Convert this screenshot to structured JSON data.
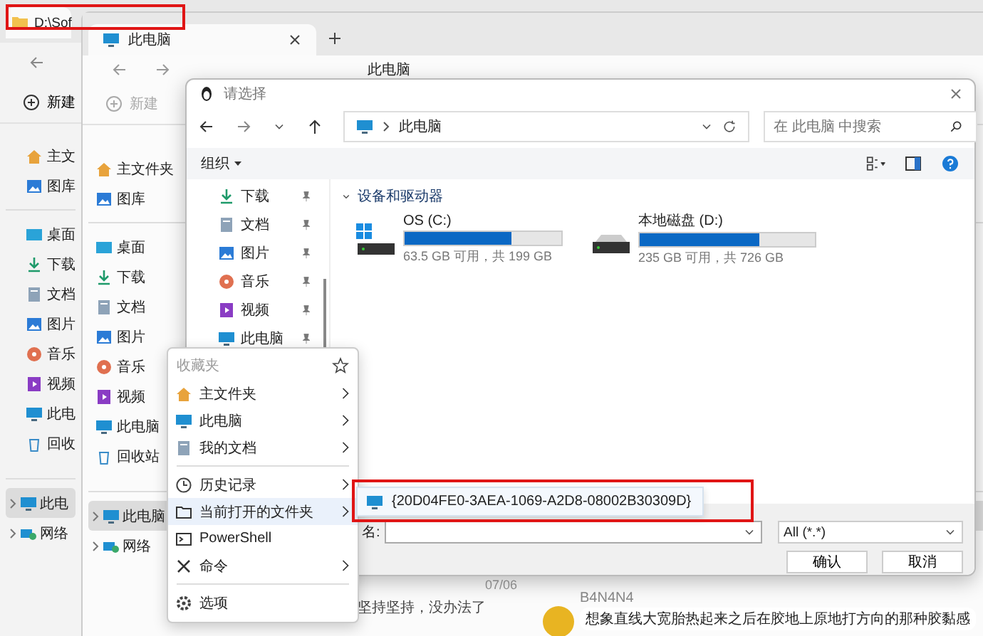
{
  "back_window": {
    "tab": "D:\\Sof",
    "new_button": "新建",
    "sidebar": [
      [
        {
          "label": "主文",
          "kind": "home"
        },
        {
          "label": "图库",
          "kind": "gallery"
        }
      ],
      [
        {
          "label": "桌面",
          "kind": "desktop"
        },
        {
          "label": "下载",
          "kind": "download"
        },
        {
          "label": "文档",
          "kind": "document"
        },
        {
          "label": "图片",
          "kind": "picture"
        },
        {
          "label": "音乐",
          "kind": "music"
        },
        {
          "label": "视频",
          "kind": "video"
        },
        {
          "label": "此电",
          "kind": "pc"
        },
        {
          "label": "回收",
          "kind": "recycle"
        }
      ]
    ],
    "tree": [
      {
        "label": "此电",
        "kind": "pc",
        "selected": true
      },
      {
        "label": "网络",
        "kind": "network",
        "selected": false
      }
    ]
  },
  "explorer": {
    "tab": "此电脑",
    "breadcrumb": "此电脑",
    "new_button": "新建",
    "sidebar": [
      [
        {
          "label": "主文件夹",
          "kind": "home"
        },
        {
          "label": "图库",
          "kind": "gallery"
        }
      ],
      [
        {
          "label": "桌面",
          "kind": "desktop"
        },
        {
          "label": "下载",
          "kind": "download"
        },
        {
          "label": "文档",
          "kind": "document"
        },
        {
          "label": "图片",
          "kind": "picture"
        },
        {
          "label": "音乐",
          "kind": "music"
        },
        {
          "label": "视频",
          "kind": "video"
        },
        {
          "label": "此电脑",
          "kind": "pc"
        },
        {
          "label": "回收站",
          "kind": "recycle"
        }
      ]
    ],
    "tree": [
      {
        "label": "此电脑",
        "kind": "pc",
        "selected": true
      },
      {
        "label": "网络",
        "kind": "network",
        "selected": false
      }
    ]
  },
  "chat": {
    "date": "07/06",
    "prev_message": "坚持坚持，没办法了",
    "author": "B4N4N4",
    "message": "想象直线大宽胎热起来之后在胶地上原地打方向的那种胶黏感"
  },
  "dialog": {
    "title": "请选择",
    "address": "此电脑",
    "search": {
      "placeholder": "在 此电脑 中搜索"
    },
    "organize": "组织",
    "quick_access": [
      {
        "label": "下载",
        "kind": "download"
      },
      {
        "label": "文档",
        "kind": "document"
      },
      {
        "label": "图片",
        "kind": "picture"
      },
      {
        "label": "音乐",
        "kind": "music"
      },
      {
        "label": "视频",
        "kind": "video"
      },
      {
        "label": "此电脑",
        "kind": "pc"
      }
    ],
    "section": "设备和驱动器",
    "drives": [
      {
        "name": "OS (C:)",
        "kind": "system",
        "level": 0.68,
        "reading": "63.5 GB 可用，共 199 GB"
      },
      {
        "name": "本地磁盘 (D:)",
        "kind": "data",
        "level": 0.68,
        "reading": "235 GB 可用，共 726 GB"
      }
    ],
    "filename_label": "名:",
    "file_type": "All (*.*)",
    "buttons": [
      "确认",
      "取消"
    ]
  },
  "context_menu": {
    "header": "收藏夹",
    "groups": [
      [
        {
          "label": "主文件夹",
          "kind": "home",
          "submenu": true,
          "selected": false
        },
        {
          "label": "此电脑",
          "kind": "pc",
          "submenu": true,
          "selected": false
        },
        {
          "label": "我的文档",
          "kind": "document",
          "submenu": true,
          "selected": false
        }
      ],
      [
        {
          "label": "历史记录",
          "kind": "clock",
          "submenu": true,
          "selected": false
        },
        {
          "label": "当前打开的文件夹",
          "kind": "folder",
          "submenu": true,
          "selected": true
        },
        {
          "label": "PowerShell",
          "kind": "terminal",
          "submenu": false,
          "selected": false
        },
        {
          "label": "命令",
          "kind": "tools",
          "submenu": true,
          "selected": false
        }
      ],
      [
        {
          "label": "选项",
          "kind": "gear",
          "submenu": false,
          "selected": false
        }
      ]
    ]
  },
  "submenu": {
    "items": [
      {
        "label": "{20D04FE0-3AEA-1069-A2D8-08002B30309D}",
        "kind": "pc"
      }
    ]
  }
}
